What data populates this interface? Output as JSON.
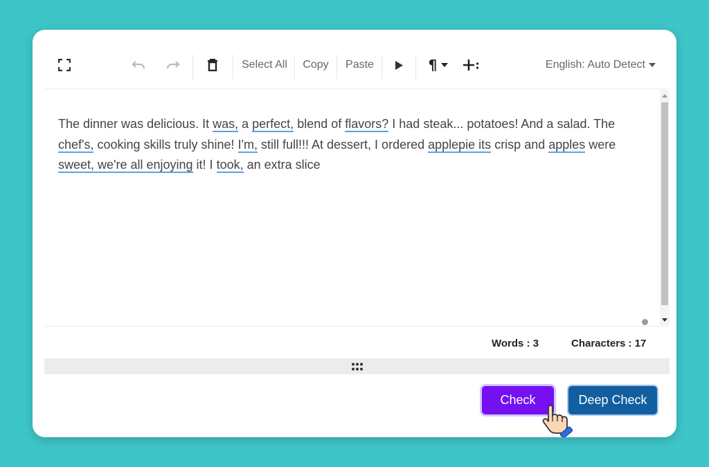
{
  "toolbar": {
    "select_all_label": "Select All",
    "copy_label": "Copy",
    "paste_label": "Paste",
    "language_label": "English: Auto Detect"
  },
  "editor": {
    "segments": [
      {
        "text": "The dinner was delicious. It ",
        "error": false
      },
      {
        "text": "was,",
        "error": true
      },
      {
        "text": " a ",
        "error": false
      },
      {
        "text": "perfect,",
        "error": true
      },
      {
        "text": " blend of ",
        "error": false
      },
      {
        "text": "flavors?",
        "error": true
      },
      {
        "text": " I had steak... potatoes! And a salad. The ",
        "error": false
      },
      {
        "text": "chef's,",
        "error": true
      },
      {
        "text": " cooking skills truly shine! ",
        "error": false
      },
      {
        "text": "I'm,",
        "error": true
      },
      {
        "text": " still full!!! At dessert, I ordered ",
        "error": false
      },
      {
        "text": "applepie its",
        "error": true
      },
      {
        "text": " crisp and ",
        "error": false
      },
      {
        "text": "apples",
        "error": true
      },
      {
        "text": " were ",
        "error": false
      },
      {
        "text": "sweet, we're all enjoying",
        "error": true
      },
      {
        "text": " it! I ",
        "error": false
      },
      {
        "text": "took,",
        "error": true
      },
      {
        "text": " an extra slice",
        "error": false
      }
    ],
    "error_underline_color": "#5aa0e8"
  },
  "stats": {
    "words_label": "Words : 3",
    "characters_label": "Characters : 17"
  },
  "buttons": {
    "check_label": "Check",
    "deep_check_label": "Deep Check"
  },
  "colors": {
    "background": "#3ec5c8",
    "check_button": "#7510f0",
    "deep_check_button": "#115fa0"
  }
}
